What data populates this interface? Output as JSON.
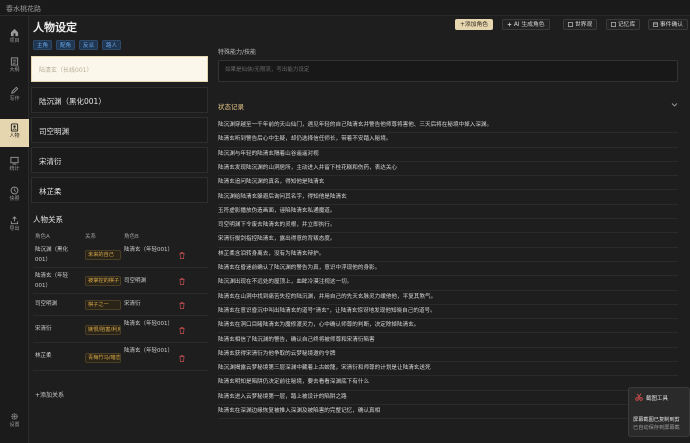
{
  "window": {
    "title": "春水桃花路"
  },
  "sidebar": {
    "items": [
      {
        "label": "项目",
        "icon": "home-icon"
      },
      {
        "label": "大纲",
        "icon": "outline-icon"
      },
      {
        "label": "写作",
        "icon": "pen-icon"
      },
      {
        "label": "人物",
        "icon": "person-icon",
        "active": true
      },
      {
        "label": "统计",
        "icon": "stats-icon"
      },
      {
        "label": "快照",
        "icon": "clock-icon"
      },
      {
        "label": "导出",
        "icon": "export-icon"
      },
      {
        "label": "设置",
        "icon": "gear-icon"
      }
    ]
  },
  "left": {
    "title": "人物设定",
    "tags": [
      "主角",
      "配角",
      "反派",
      "路人"
    ],
    "editing_placeholder": "陆清玄（长线001）",
    "characters": [
      "陆沉渊（黑化001）",
      "司空明渊",
      "宋清衍",
      "林芷柔"
    ],
    "relations": {
      "title": "人物关系",
      "headers": [
        "角色A",
        "关系",
        "角色B"
      ],
      "rows": [
        {
          "a": "陆沉渊（黑化001）",
          "rel": "未来的自己",
          "b": "陆清玄（年轻001）"
        },
        {
          "a": "陆清玄（年轻001）",
          "rel": "被掌控的棋子",
          "b": "司空明渊"
        },
        {
          "a": "司空明渊",
          "rel": "棋子之一",
          "b": "宋清衍"
        },
        {
          "a": "宋清衍",
          "rel": "嫉恨/陷害/利用",
          "b": "陆清玄（年轻001）"
        },
        {
          "a": "林芷柔",
          "rel": "青梅竹马/暗恋",
          "b": "陆清玄（年轻001）"
        }
      ],
      "add_label": "+添加关系"
    }
  },
  "toolbar": {
    "add_character": "+添加角色",
    "ai_generate": "AI 生成角色",
    "world": "世界观",
    "memory": "记忆库",
    "events": "事件确认"
  },
  "right": {
    "ability_label": "特殊能力/技能",
    "ability_placeholder": "如果是仙侠/无限流，写出能力设定",
    "status_label": "状态记录",
    "status_items": [
      "陆沉渊穿越至一千年前的天山仙门，遇见年轻的自己陆清玄并警告他师尊将害他、三天后将在秘境中掉入深渊。",
      "陆清玄听到警告后心中生疑，却仍选择信任师长，带着不安踏入秘境。",
      "陆沉渊与年轻的陆清玄隔着山谷遥遥对视",
      "陆清玄发现陆沉渊的山洞居所，主动进入并留下桂花糕和伤药，表达关心",
      "陆清玄追问陆沉渊的真名，得知他是陆清玄",
      "陆沉渊给陆清玄躲避后询问其名字，得知他是陆清玄",
      "玉符虚影播放伪造画面，诬陷陆清玄私通魔道。",
      "司空明渊下令废去陆清玄的灵根，并立即执行。",
      "宋清衍拔剑指控陆清玄，露出得意的背叛态度。",
      "林芷柔含泪转身离去，没有为陆清玄辩护。",
      "陆清玄在昏迷前确认了陆沉渊的警告为真，意识中浮现他的身影。",
      "陆沉渊出现在不远处的屋顶上，血眸冷漠注视这一切。",
      "陆清玄在山洞中找到痛苦失控的陆沉渊，并用自己的先天玄脉灵力缓他他，平复其煞气。",
      "陆清玄在意识昏沉中叫出陆清玄的道号\"清玄\"，让陆清玄惊讶地发现他知晓自己的道号。",
      "陆清玄在洞口目睹陆清玄为魔修渡灵力，心中确认师尊的判断，决定除掉陆清玄。",
      "陆清玄相信了陆沉渊的警告，确认自己终将被师尊和宋清衍陷害",
      "陆清玄获得宋清衍为他争取的云梦秘境邀约令牌",
      "陆沉渊揭露云梦秘境第三层深渊中藏着上古蛟龍，宋清衍和师尊的计划是让陆清玄送死",
      "陆清玄明知是陷阱仍决定前往秘境，要去看看深渊底下有什么",
      "陆清玄进入云梦秘境第一层，踏上被设计的陷阱之路",
      "陆清玄在深渊边缘恢复被推入深渊及被陷害的完整记忆，确认真相"
    ]
  },
  "toast": {
    "title": "截图工具",
    "line1": "屏幕截图已复制到剪",
    "line2": "已自动保存到屏幕截"
  },
  "colors": {
    "accent": "#e6d6b0",
    "background": "#1e1e1e",
    "status_title": "#e6c88a",
    "tag_blue": "#6aa8e8",
    "chip_gold": "#d6a64a"
  }
}
